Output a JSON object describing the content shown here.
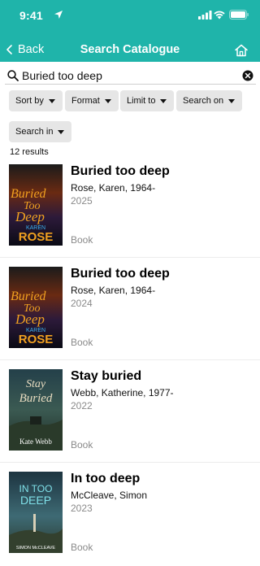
{
  "status_bar": {
    "time": "9:41"
  },
  "header": {
    "back_label": "Back",
    "title": "Search Catalogue"
  },
  "search": {
    "value": "Buried too deep",
    "placeholder": ""
  },
  "filters": [
    "Sort by",
    "Format",
    "Limit to",
    "Search on",
    "Search in"
  ],
  "results_count": "12 results",
  "results": [
    {
      "title": "Buried too deep",
      "author": "Rose, Karen, 1964-",
      "year": "2025",
      "format": "Book",
      "cover": {
        "line1": "Buried",
        "line2": "Too",
        "line3": "Deep",
        "author": "KAREN",
        "author2": "ROSE"
      }
    },
    {
      "title": "Buried too deep",
      "author": "Rose, Karen, 1964-",
      "year": "2024",
      "format": "Book",
      "cover": {
        "line1": "Buried",
        "line2": "Too",
        "line3": "Deep",
        "author": "KAREN",
        "author2": "ROSE"
      }
    },
    {
      "title": "Stay buried",
      "author": "Webb, Katherine, 1977-",
      "year": "2022",
      "format": "Book",
      "cover": {
        "line1": "Stay",
        "line2": "Buried",
        "author": "Kate Webb"
      }
    },
    {
      "title": "In too deep",
      "author": "McCleave, Simon",
      "year": "2023",
      "format": "Book",
      "cover": {
        "line1": "IN TOO",
        "line2": "DEEP",
        "author": "SIMON McCLEAVE"
      }
    }
  ],
  "colors": {
    "header": "#1fb4aa",
    "chip": "#e6e6e6"
  },
  "icons": [
    "location-arrow-icon",
    "signal-icon",
    "wifi-icon",
    "battery-icon",
    "chevron-left-icon",
    "home-icon",
    "search-icon",
    "clear-icon",
    "caret-down-icon"
  ]
}
